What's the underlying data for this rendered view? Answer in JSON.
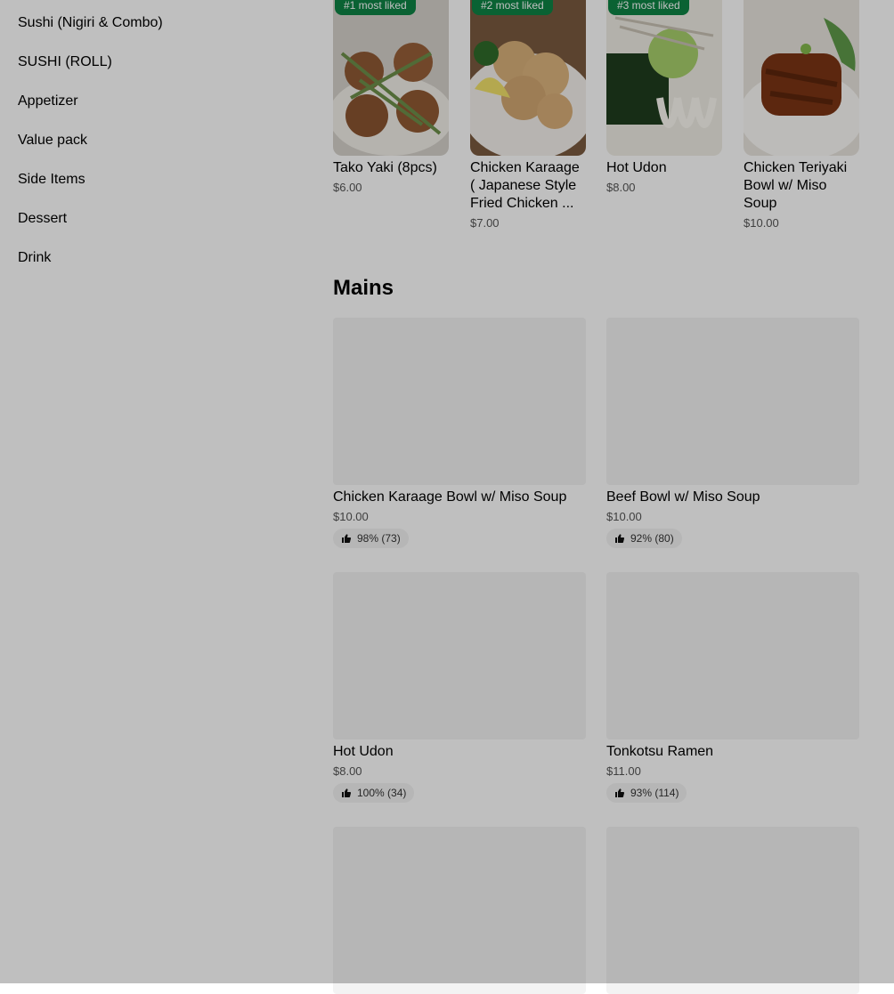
{
  "sidebar": {
    "items": [
      {
        "label": "Sushi (Nigiri & Combo)"
      },
      {
        "label": "SUSHI (ROLL)"
      },
      {
        "label": "Appetizer"
      },
      {
        "label": "Value pack"
      },
      {
        "label": "Side Items"
      },
      {
        "label": "Dessert"
      },
      {
        "label": "Drink"
      }
    ]
  },
  "featured": {
    "items": [
      {
        "badge": "#1 most liked",
        "name": "Tako Yaki (8pcs)",
        "price": "$6.00"
      },
      {
        "badge": "#2 most liked",
        "name": "Chicken Karaage ( Japanese Style Fried Chicken ...",
        "price": "$7.00"
      },
      {
        "badge": "#3 most liked",
        "name": "Hot Udon",
        "price": "$8.00"
      },
      {
        "badge": "",
        "name": "Chicken Teriyaki Bowl w/ Miso Soup",
        "price": "$10.00"
      }
    ]
  },
  "mains": {
    "title": "Mains",
    "items": [
      {
        "name": "Chicken Karaage Bowl w/ Miso Soup",
        "price": "$10.00",
        "rating": "98% (73)"
      },
      {
        "name": "Beef Bowl w/ Miso Soup",
        "price": "$10.00",
        "rating": "92% (80)"
      },
      {
        "name": "Hot Udon",
        "price": "$8.00",
        "rating": "100% (34)"
      },
      {
        "name": "Tonkotsu Ramen",
        "price": "$11.00",
        "rating": "93% (114)"
      }
    ]
  },
  "colors": {
    "badge": "#0e8345",
    "overlay": "rgba(0,0,0,0.25)"
  },
  "icons": {
    "thumbs_up": "thumbs-up-icon"
  }
}
